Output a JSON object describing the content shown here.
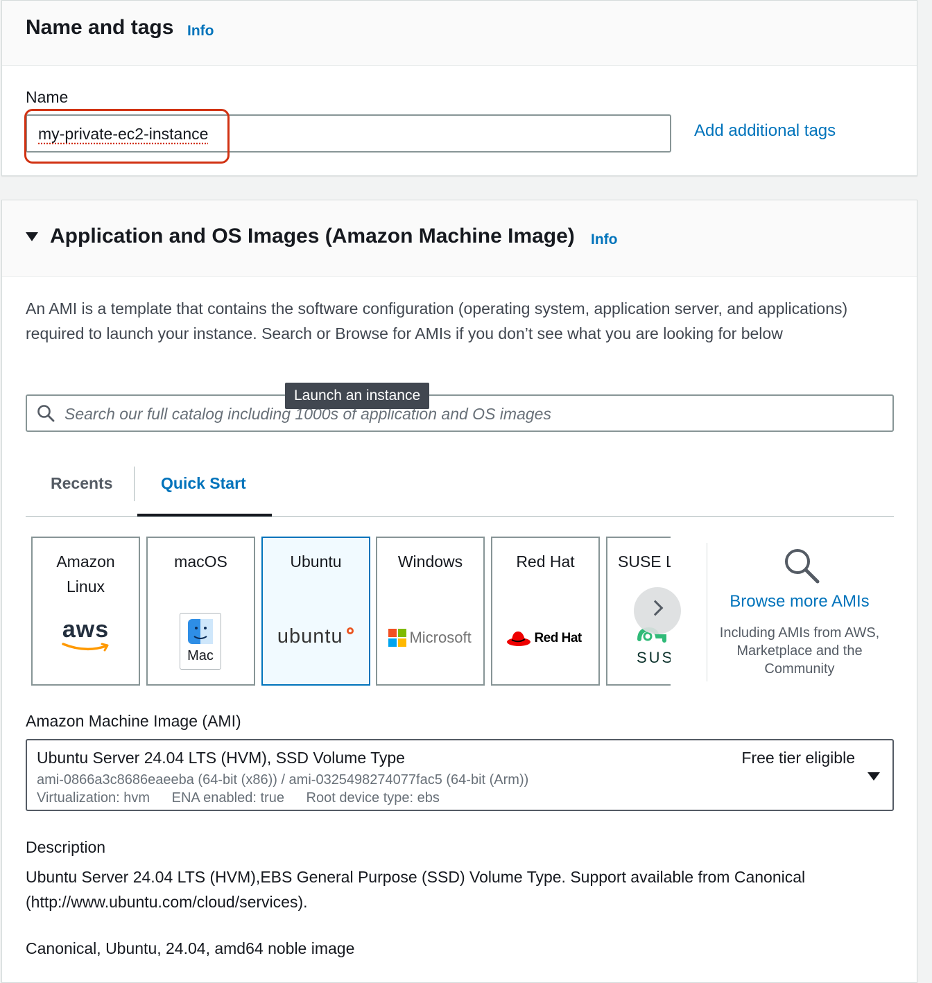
{
  "name_panel": {
    "title": "Name and tags",
    "info": "Info",
    "name_label": "Name",
    "name_value": "my-private-ec2-instance",
    "add_tags": "Add additional tags"
  },
  "ami_panel": {
    "title": "Application and OS Images (Amazon Machine Image)",
    "info": "Info",
    "description": "An AMI is a template that contains the software configuration (operating system, application server, and applications) required to launch your instance. Search or Browse for AMIs if you don’t see what you are looking for below",
    "search_placeholder": "Search our full catalog including 1000s of application and OS images",
    "tooltip": "Launch an instance",
    "tabs": [
      {
        "label": "Recents",
        "active": false
      },
      {
        "label": "Quick Start",
        "active": true
      }
    ],
    "os_cards": [
      {
        "name": "Amazon Linux",
        "logo_text": "aws",
        "logo_icon": "aws-smile-icon"
      },
      {
        "name": "macOS",
        "logo_text": "Mac",
        "logo_icon": "finder-icon"
      },
      {
        "name": "Ubuntu",
        "logo_text": "ubuntu",
        "logo_icon": "ubuntu-circle-icon",
        "selected": true
      },
      {
        "name": "Windows",
        "logo_text": "Microsoft",
        "logo_icon": "microsoft-squares-icon"
      },
      {
        "name": "Red Hat",
        "logo_text": "Red Hat",
        "logo_icon": "redhat-fedora-icon"
      },
      {
        "name": "SUSE L",
        "logo_text": "SUS",
        "logo_icon": "suse-chameleon-icon"
      }
    ],
    "browse": {
      "link": "Browse more AMIs",
      "sub": "Including AMIs from AWS, Marketplace and the Community"
    },
    "ami_label": "Amazon Machine Image (AMI)",
    "ami_select": {
      "name": "Ubuntu Server 24.04 LTS (HVM), SSD Volume Type",
      "ids": "ami-0866a3c8686eaeeba (64-bit (x86)) / ami-0325498274077fac5 (64-bit (Arm))",
      "virtualization": "Virtualization: hvm",
      "ena": "ENA enabled: true",
      "root_device": "Root device type: ebs",
      "badge": "Free tier eligible"
    },
    "desc_label": "Description",
    "desc_text": "Ubuntu Server 24.04 LTS (HVM),EBS General Purpose (SSD) Volume Type. Support available from Canonical (http://www.ubuntu.com/cloud/services).",
    "desc_tags": "Canonical, Ubuntu, 24.04, amd64 noble image"
  },
  "colors": {
    "link": "#0073bb",
    "highlight": "#d13212",
    "text": "#16191f",
    "selected_bg": "#f1faff"
  }
}
